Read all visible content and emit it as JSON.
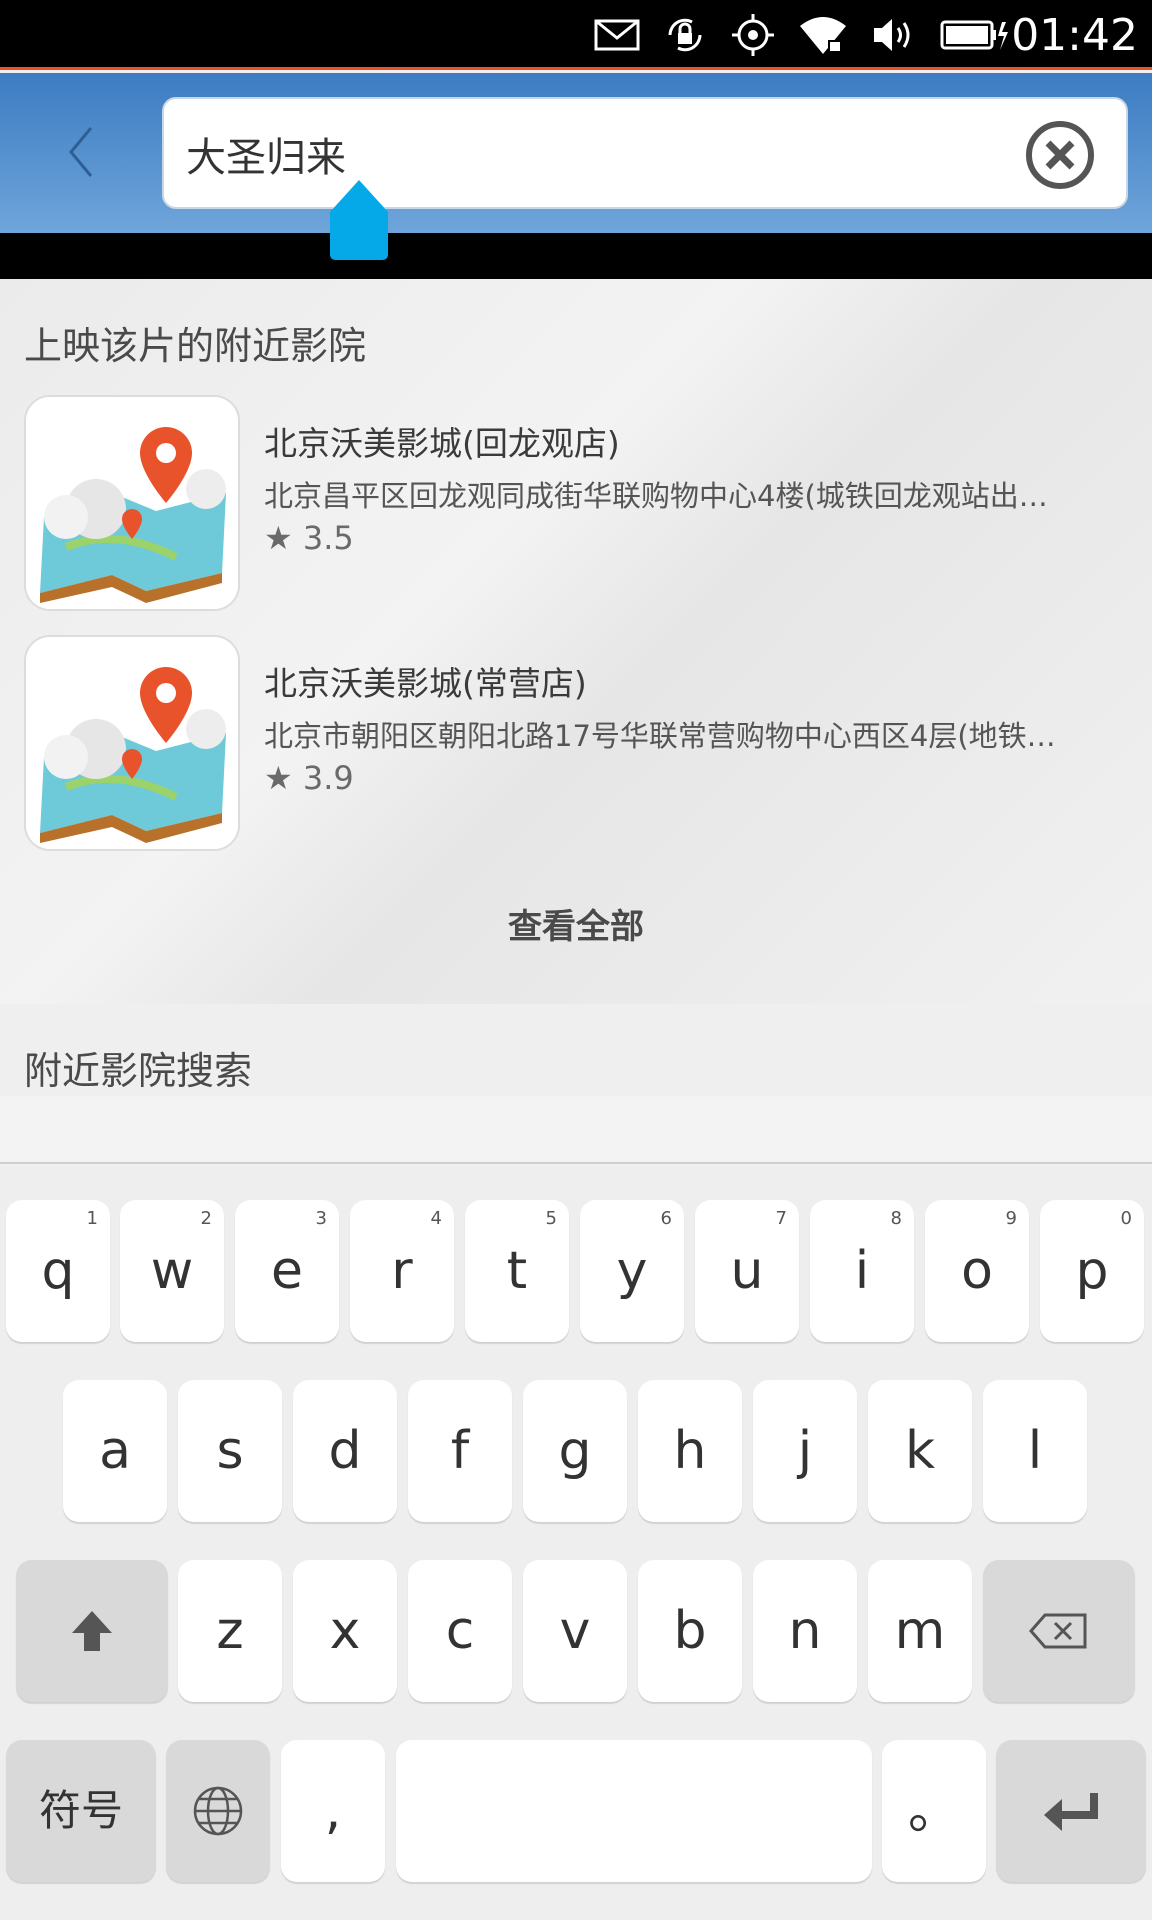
{
  "status_bar": {
    "time": "01:42",
    "icons": [
      "mail-icon",
      "rotation-lock-icon",
      "location-icon",
      "wifi-icon",
      "volume-icon",
      "battery-charging-icon"
    ]
  },
  "header": {
    "back_icon": "chevron-left-icon",
    "search": {
      "value": "大圣归来",
      "clear_icon": "clear-circle-icon"
    }
  },
  "nearby_showing": {
    "title": "上映该片的附近影院",
    "cinemas": [
      {
        "name": "北京沃美影城(回龙观店)",
        "address": "北京昌平区回龙观同成街华联购物中心4楼(城铁回龙观站出…",
        "rating": "★ 3.5",
        "thumb_icon": "map-pin-icon"
      },
      {
        "name": "北京沃美影城(常营店)",
        "address": "北京市朝阳区朝阳北路17号华联常营购物中心西区4层(地铁…",
        "rating": "★ 3.9",
        "thumb_icon": "map-pin-icon"
      }
    ],
    "view_all": "查看全部"
  },
  "nearby_search": {
    "title": "附近影院搜索"
  },
  "keyboard": {
    "row1": [
      {
        "key": "q",
        "num": "1"
      },
      {
        "key": "w",
        "num": "2"
      },
      {
        "key": "e",
        "num": "3"
      },
      {
        "key": "r",
        "num": "4"
      },
      {
        "key": "t",
        "num": "5"
      },
      {
        "key": "y",
        "num": "6"
      },
      {
        "key": "u",
        "num": "7"
      },
      {
        "key": "i",
        "num": "8"
      },
      {
        "key": "o",
        "num": "9"
      },
      {
        "key": "p",
        "num": "0"
      }
    ],
    "row2": [
      "a",
      "s",
      "d",
      "f",
      "g",
      "h",
      "j",
      "k",
      "l"
    ],
    "row3": [
      "z",
      "x",
      "c",
      "v",
      "b",
      "n",
      "m"
    ],
    "symbols": "符号",
    "comma": ",",
    "period": "。",
    "shift_icon": "shift-icon",
    "backspace_icon": "backspace-icon",
    "globe_icon": "globe-icon",
    "enter_icon": "enter-icon"
  }
}
